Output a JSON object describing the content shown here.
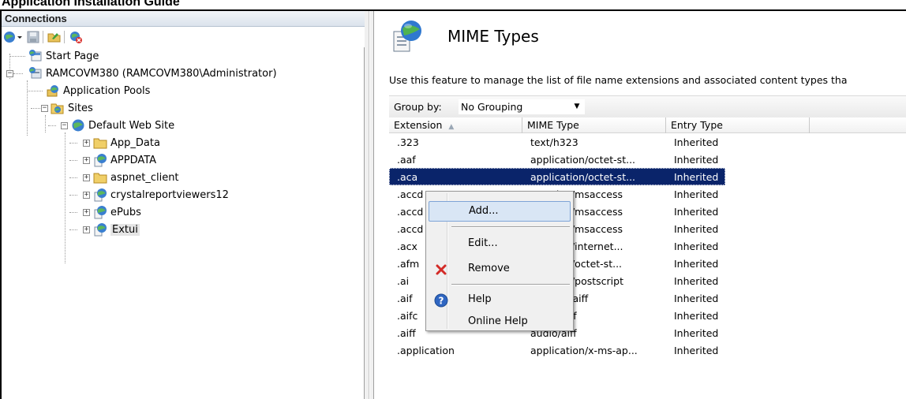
{
  "document": {
    "header": "Application Installation Guide"
  },
  "connections": {
    "title": "Connections",
    "tree": [
      {
        "label": "Start Page",
        "icon": "start-page-icon"
      },
      {
        "label": "RAMCOVM380 (RAMCOVM380\\Administrator)",
        "icon": "server-icon"
      },
      {
        "label": "Application Pools",
        "icon": "app-pools-icon"
      },
      {
        "label": "Sites",
        "icon": "sites-folder-icon"
      },
      {
        "label": "Default Web Site",
        "icon": "globe-icon"
      },
      {
        "label": "App_Data",
        "icon": "folder-icon"
      },
      {
        "label": "APPDATA",
        "icon": "web-app-icon"
      },
      {
        "label": "aspnet_client",
        "icon": "folder-icon"
      },
      {
        "label": "crystalreportviewers12",
        "icon": "web-app-icon"
      },
      {
        "label": "ePubs",
        "icon": "web-app-icon"
      },
      {
        "label": "Extui",
        "icon": "web-app-icon",
        "selected": true
      }
    ]
  },
  "feature": {
    "title": "MIME Types",
    "description": "Use this feature to manage the list of file name extensions and associated content types tha",
    "group_by_label": "Group by:",
    "group_by_value": "No Grouping",
    "columns": [
      "Extension",
      "MIME Type",
      "Entry Type"
    ],
    "rows": [
      {
        "ext": ".323",
        "mime": "text/h323",
        "entry": "Inherited"
      },
      {
        "ext": ".aaf",
        "mime": "application/octet-st...",
        "entry": "Inherited"
      },
      {
        "ext": ".aca",
        "mime": "application/octet-st...",
        "entry": "Inherited",
        "selected": true
      },
      {
        "ext": ".accd",
        "mime": "tion/msaccess",
        "entry": "Inherited"
      },
      {
        "ext": ".accd",
        "mime": "tion/msaccess",
        "entry": "Inherited"
      },
      {
        "ext": ".accd",
        "mime": "tion/msaccess",
        "entry": "Inherited"
      },
      {
        "ext": ".acx",
        "mime": "tion/internet...",
        "entry": "Inherited"
      },
      {
        "ext": ".afm",
        "mime": "tion/octet-st...",
        "entry": "Inherited"
      },
      {
        "ext": ".ai",
        "mime": "tion/postscript",
        "entry": "Inherited"
      },
      {
        "ext": ".aif",
        "mime": "-aiff",
        "entry": "Inherited"
      },
      {
        "ext": ".aifc",
        "mime": "audio/aiff",
        "entry": "Inherited"
      },
      {
        "ext": ".aiff",
        "mime": "audio/aiff",
        "entry": "Inherited"
      },
      {
        "ext": ".application",
        "mime": "application/x-ms-ap...",
        "entry": "Inherited"
      }
    ]
  },
  "context_menu": {
    "add": "Add...",
    "edit": "Edit...",
    "remove": "Remove",
    "help": "Help",
    "online_help": "Online Help"
  },
  "colors": {
    "selection": "#0a246a",
    "menu_highlight": "#d9e6f5"
  }
}
